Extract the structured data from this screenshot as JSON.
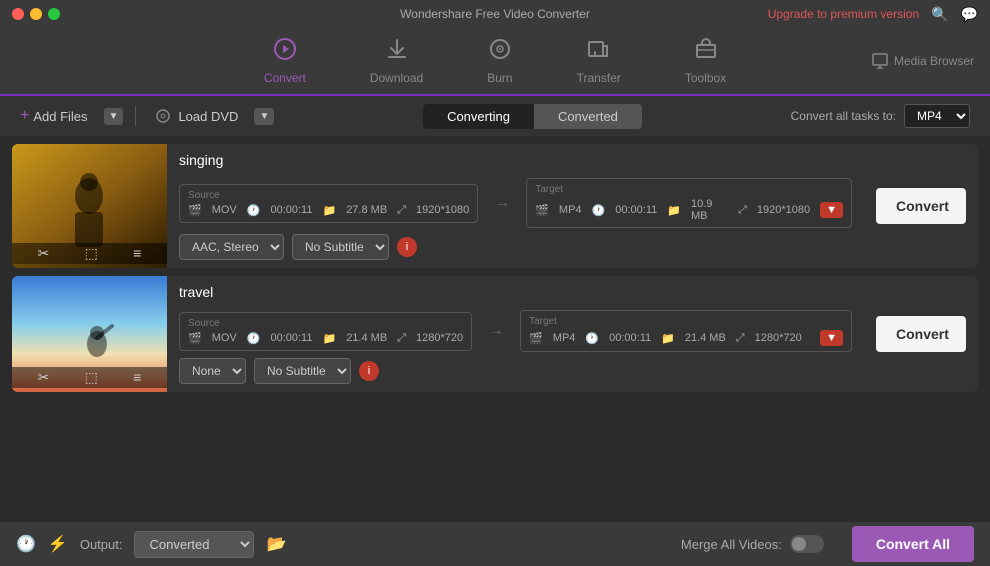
{
  "app": {
    "title": "Wondershare Free Video Converter",
    "upgrade_link": "Upgrade to premium version"
  },
  "nav": {
    "items": [
      {
        "id": "convert",
        "label": "Convert",
        "icon": "▶",
        "active": true
      },
      {
        "id": "download",
        "label": "Download",
        "icon": "⬇"
      },
      {
        "id": "burn",
        "label": "Burn",
        "icon": "⏺"
      },
      {
        "id": "transfer",
        "label": "Transfer",
        "icon": "⇄"
      },
      {
        "id": "toolbox",
        "label": "Toolbox",
        "icon": "⚙"
      }
    ],
    "media_browser": "Media Browser"
  },
  "toolbar": {
    "add_files": "Add Files",
    "load_dvd": "Load DVD",
    "tabs": {
      "converting": "Converting",
      "converted": "Converted",
      "active": "converting"
    },
    "convert_all_to": "Convert all tasks to:",
    "format": "MP4"
  },
  "files": [
    {
      "id": "singing",
      "name": "singing",
      "thumbnail_type": "singing",
      "source": {
        "label": "Source",
        "format": "MOV",
        "duration": "00:00:11",
        "size": "27.8 MB",
        "resolution": "1920*1080"
      },
      "target": {
        "label": "Target",
        "format": "MP4",
        "duration": "00:00:11",
        "size": "10.9 MB",
        "resolution": "1920*1080"
      },
      "audio": "AAC, Stereo",
      "subtitle": "No Subtitle",
      "convert_btn": "Convert"
    },
    {
      "id": "travel",
      "name": "travel",
      "thumbnail_type": "travel",
      "source": {
        "label": "Source",
        "format": "MOV",
        "duration": "00:00:11",
        "size": "21.4 MB",
        "resolution": "1280*720"
      },
      "target": {
        "label": "Target",
        "format": "MP4",
        "duration": "00:00:11",
        "size": "21.4 MB",
        "resolution": "1280*720"
      },
      "audio": "None",
      "subtitle": "No Subtitle",
      "convert_btn": "Convert"
    }
  ],
  "bottom": {
    "output_label": "Output:",
    "output_value": "Converted",
    "merge_label": "Merge All Videos:",
    "convert_all": "Convert All"
  },
  "icons": {
    "clock": "🕐",
    "lightning": "⚡",
    "folder_open": "📂",
    "film": "🎬",
    "scissors": "✂",
    "crop": "⬚",
    "equalizer": "≡",
    "search": "🔍",
    "message": "💬"
  }
}
